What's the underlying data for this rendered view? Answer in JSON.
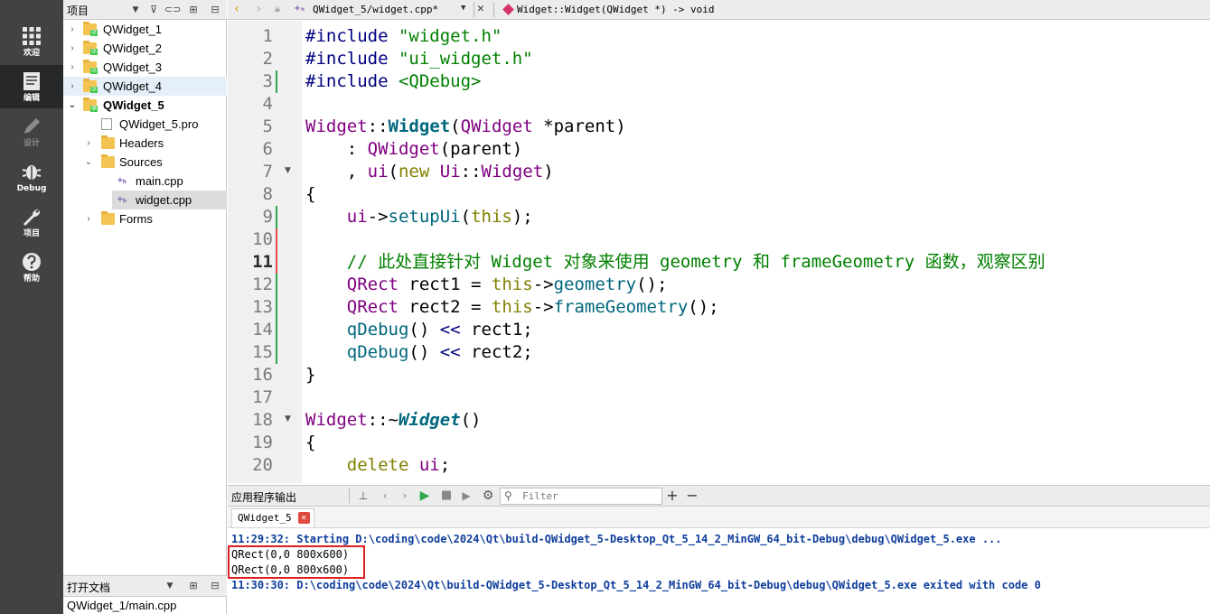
{
  "modebar": {
    "items": [
      {
        "label": "欢迎",
        "icon": "grid-icon"
      },
      {
        "label": "编辑",
        "icon": "edit-doc-icon"
      },
      {
        "label": "设计",
        "icon": "pen-icon"
      },
      {
        "label": "Debug",
        "icon": "bug-icon"
      },
      {
        "label": "项目",
        "icon": "wrench-icon"
      },
      {
        "label": "帮助",
        "icon": "help-icon"
      }
    ]
  },
  "project_panel": {
    "title": "项目",
    "tree": [
      {
        "label": "QWidget_1"
      },
      {
        "label": "QWidget_2"
      },
      {
        "label": "QWidget_3"
      },
      {
        "label": "QWidget_4"
      },
      {
        "label": "QWidget_5"
      },
      {
        "label": "QWidget_5.pro"
      },
      {
        "label": "Headers"
      },
      {
        "label": "Sources"
      },
      {
        "label": "main.cpp"
      },
      {
        "label": "widget.cpp"
      },
      {
        "label": "Forms"
      }
    ]
  },
  "open_docs": {
    "title": "打开文档",
    "items": [
      "QWidget_1/main.cpp"
    ]
  },
  "editor_bar": {
    "file": "QWidget_5/widget.cpp*",
    "symbol": "Widget::Widget(QWidget *) -> void"
  },
  "editor": {
    "line_numbers": [
      "1",
      "2",
      "3",
      "4",
      "5",
      "6",
      "7",
      "8",
      "9",
      "10",
      "11",
      "12",
      "13",
      "14",
      "15",
      "16",
      "17",
      "18",
      "19",
      "20"
    ],
    "current_line": 11,
    "code": {
      "l1_pp": "#include",
      "l1_str": "\"widget.h\"",
      "l2_pp": "#include",
      "l2_str": "\"ui_widget.h\"",
      "l3_pp": "#include",
      "l3_str": "<QDebug>",
      "l5_ty": "Widget",
      "l5_op1": "::",
      "l5_fn": "Widget",
      "l5_op2": "(",
      "l5_ty2": "QWidget",
      "l5_rest": " *parent)",
      "l6_op": "    : ",
      "l6_ty": "QWidget",
      "l6_rest": "(parent)",
      "l7_op": "    , ",
      "l7_ty": "ui",
      "l7_op2": "(",
      "l7_kw": "new",
      "l7_sp": " ",
      "l7_ty2": "Ui",
      "l7_op3": "::",
      "l7_ty3": "Widget",
      "l7_op4": ")",
      "l8": "{",
      "l9_ind": "    ",
      "l9_ty": "ui",
      "l9_op": "->",
      "l9_fn": "setupUi",
      "l9_op2": "(",
      "l9_kw": "this",
      "l9_op3": ");",
      "l11_ind": "    ",
      "l11_cm": "// 此处直接针对 Widget 对象来使用 geometry 和 frameGeometry 函数，观察区别",
      "l12_ind": "    ",
      "l12_ty": "QRect",
      "l12_mid": " rect1 = ",
      "l12_kw": "this",
      "l12_op": "->",
      "l12_fn": "geometry",
      "l12_op2": "();",
      "l13_ind": "    ",
      "l13_ty": "QRect",
      "l13_mid": " rect2 = ",
      "l13_kw": "this",
      "l13_op": "->",
      "l13_fn": "frameGeometry",
      "l13_op2": "();",
      "l14_ind": "    ",
      "l14_fn": "qDebug",
      "l14_op": "() ",
      "l14_pp": "<<",
      "l14_rest": " rect1;",
      "l15_ind": "    ",
      "l15_fn": "qDebug",
      "l15_op": "() ",
      "l15_pp": "<<",
      "l15_rest": " rect2;",
      "l16": "}",
      "l18_ty": "Widget",
      "l18_op": "::~",
      "l18_fn": "Widget",
      "l18_op2": "()",
      "l19": "{",
      "l20_ind": "    ",
      "l20_kw": "delete",
      "l20_sp": " ",
      "l20_ty": "ui",
      "l20_op": ";"
    }
  },
  "output": {
    "title": "应用程序输出",
    "filter_placeholder": "Filter",
    "tab": "QWidget_5",
    "lines": [
      "11:29:32: Starting D:\\coding\\code\\2024\\Qt\\build-QWidget_5-Desktop_Qt_5_14_2_MinGW_64_bit-Debug\\debug\\QWidget_5.exe ...",
      "QRect(0,0 800x600)",
      "QRect(0,0 800x600)",
      "11:30:30: D:\\coding\\code\\2024\\Qt\\build-QWidget_5-Desktop_Qt_5_14_2_MinGW_64_bit-Debug\\debug\\QWidget_5.exe exited with code 0"
    ]
  },
  "colors": {
    "modebar_bg": "#404244",
    "highlight_box": "#e02020",
    "info_text": "#0e3d9c"
  }
}
